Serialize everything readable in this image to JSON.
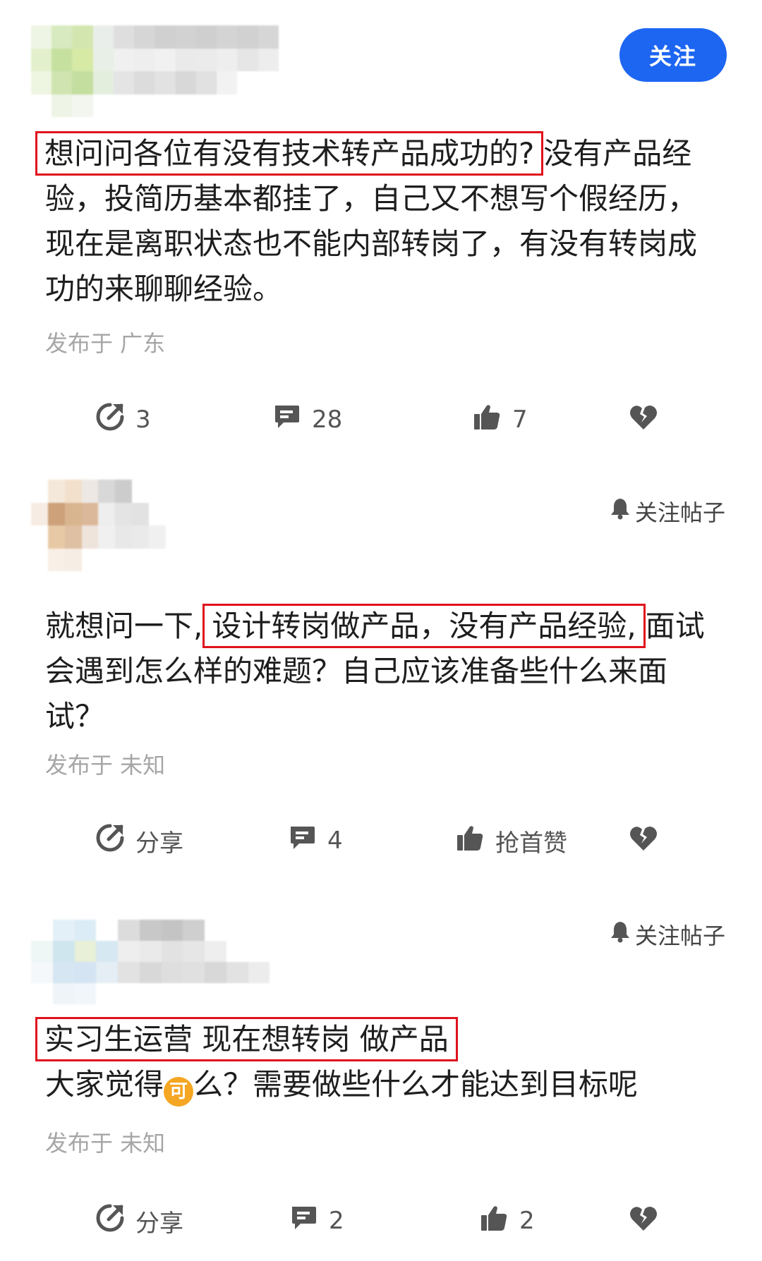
{
  "posts": [
    {
      "follow_label": "关注",
      "highlight": "想问问各位有没有技术转产品成功的?",
      "text_rest": "没有产品经验，投简历基本都挂了，自己又不想写个假经历，现在是离职状态也不能内部转岗了，有没有转岗成功的来聊聊经验。",
      "location": "发布于 广东",
      "actions": {
        "share": "3",
        "comments": "28",
        "likes": "7"
      }
    },
    {
      "follow_label": "关注帖子",
      "text_before": "就想问一下,",
      "highlight": "设计转岗做产品，没有产品经验,",
      "text_rest": "面试会遇到怎么样的难题？自己应该准备些什么来面试？",
      "location": "发布于 未知",
      "actions": {
        "share": "分享",
        "comments": "4",
        "likes": "抢首赞"
      }
    },
    {
      "follow_label": "关注帖子",
      "highlight": "实习生运营 现在想转岗 做产品",
      "text_a": "大家觉得",
      "emoji": "可",
      "text_b": "么？需要做些什么才能达到目标呢",
      "location": "发布于 未知",
      "actions": {
        "share": "分享",
        "comments": "2",
        "likes": "2"
      }
    }
  ],
  "icons": [
    "share-icon",
    "comment-icon",
    "thumbs-up-icon",
    "broken-heart-icon",
    "bell-icon"
  ],
  "colors": {
    "accent": "#1d66f2",
    "highlight_border": "#e0121c",
    "muted": "#a6a6a6"
  }
}
